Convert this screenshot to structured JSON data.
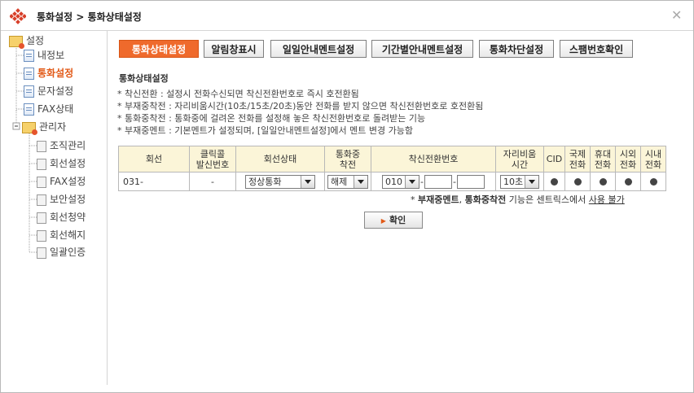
{
  "window": {
    "title": "통화설정 > 통화상태설정",
    "close_glyph": "✕"
  },
  "sidebar": {
    "root": "설정",
    "items": [
      {
        "label": "내정보"
      },
      {
        "label": "통화설정",
        "active": true
      },
      {
        "label": "문자설정"
      },
      {
        "label": "FAX상태"
      }
    ],
    "admin": {
      "label": "관리자",
      "items": [
        {
          "label": "조직관리"
        },
        {
          "label": "회선설정"
        },
        {
          "label": "FAX설정"
        },
        {
          "label": "보안설정"
        },
        {
          "label": "회선청약"
        },
        {
          "label": "회선해지"
        },
        {
          "label": "일괄인증"
        }
      ]
    }
  },
  "tabs": [
    {
      "label": "통화상태설정",
      "active": true
    },
    {
      "label": "알림창표시"
    },
    {
      "label": "일일안내멘트설정"
    },
    {
      "label": "기간별안내멘트설정"
    },
    {
      "label": "통화차단설정"
    },
    {
      "label": "스팸번호확인"
    }
  ],
  "section": {
    "title": "통화상태설정",
    "notes": [
      "* 착신전환 : 설정시 전화수신되면 착신전환번호로 즉시 호전환됨",
      "* 부재중착전 : 자리비움시간(10초/15초/20초)동안 전화를 받지 않으면 착신전환번호로 호전환됨",
      "* 통화중착전 : 통화중에 걸려온 전화를 설정해 놓은 착신전환번호로 돌려받는 기능",
      "* 부재중멘트 : 기본멘트가 설정되며, [일일안내멘트설정]에서 멘트 변경 가능함"
    ]
  },
  "table": {
    "headers": {
      "line": "회선",
      "click_caller_1": "클릭콜",
      "click_caller_2": "발신번호",
      "line_status": "회선상태",
      "busy_forward_1": "통화중",
      "busy_forward_2": "착전",
      "forward_number": "착신전환번호",
      "away_time_1": "자리비움",
      "away_time_2": "시간",
      "cid": "CID",
      "intl_1": "국제",
      "intl_2": "전화",
      "mobile_1": "휴대",
      "mobile_2": "전화",
      "outside_1": "시외",
      "outside_2": "전화",
      "local_1": "시내",
      "local_2": "전화"
    },
    "row": {
      "line": "031-",
      "click_caller": "-",
      "line_status": "정상통화",
      "busy_forward": "해제",
      "forward_prefix": "010",
      "forward_mid": "",
      "forward_last": "",
      "away_time": "10초"
    }
  },
  "footnote": {
    "prefix": "* ",
    "b1": "부재중멘트",
    "sep": ", ",
    "b2": "통화중착전",
    "mid": " 기능은 센트릭스에서 ",
    "link": "사용 불가"
  },
  "confirm_button": {
    "label": "확인",
    "glyph": "▶"
  },
  "colors": {
    "accent": "#ef6a2c",
    "header_bg": "#fbf5d8",
    "active_text": "#e25a18"
  }
}
